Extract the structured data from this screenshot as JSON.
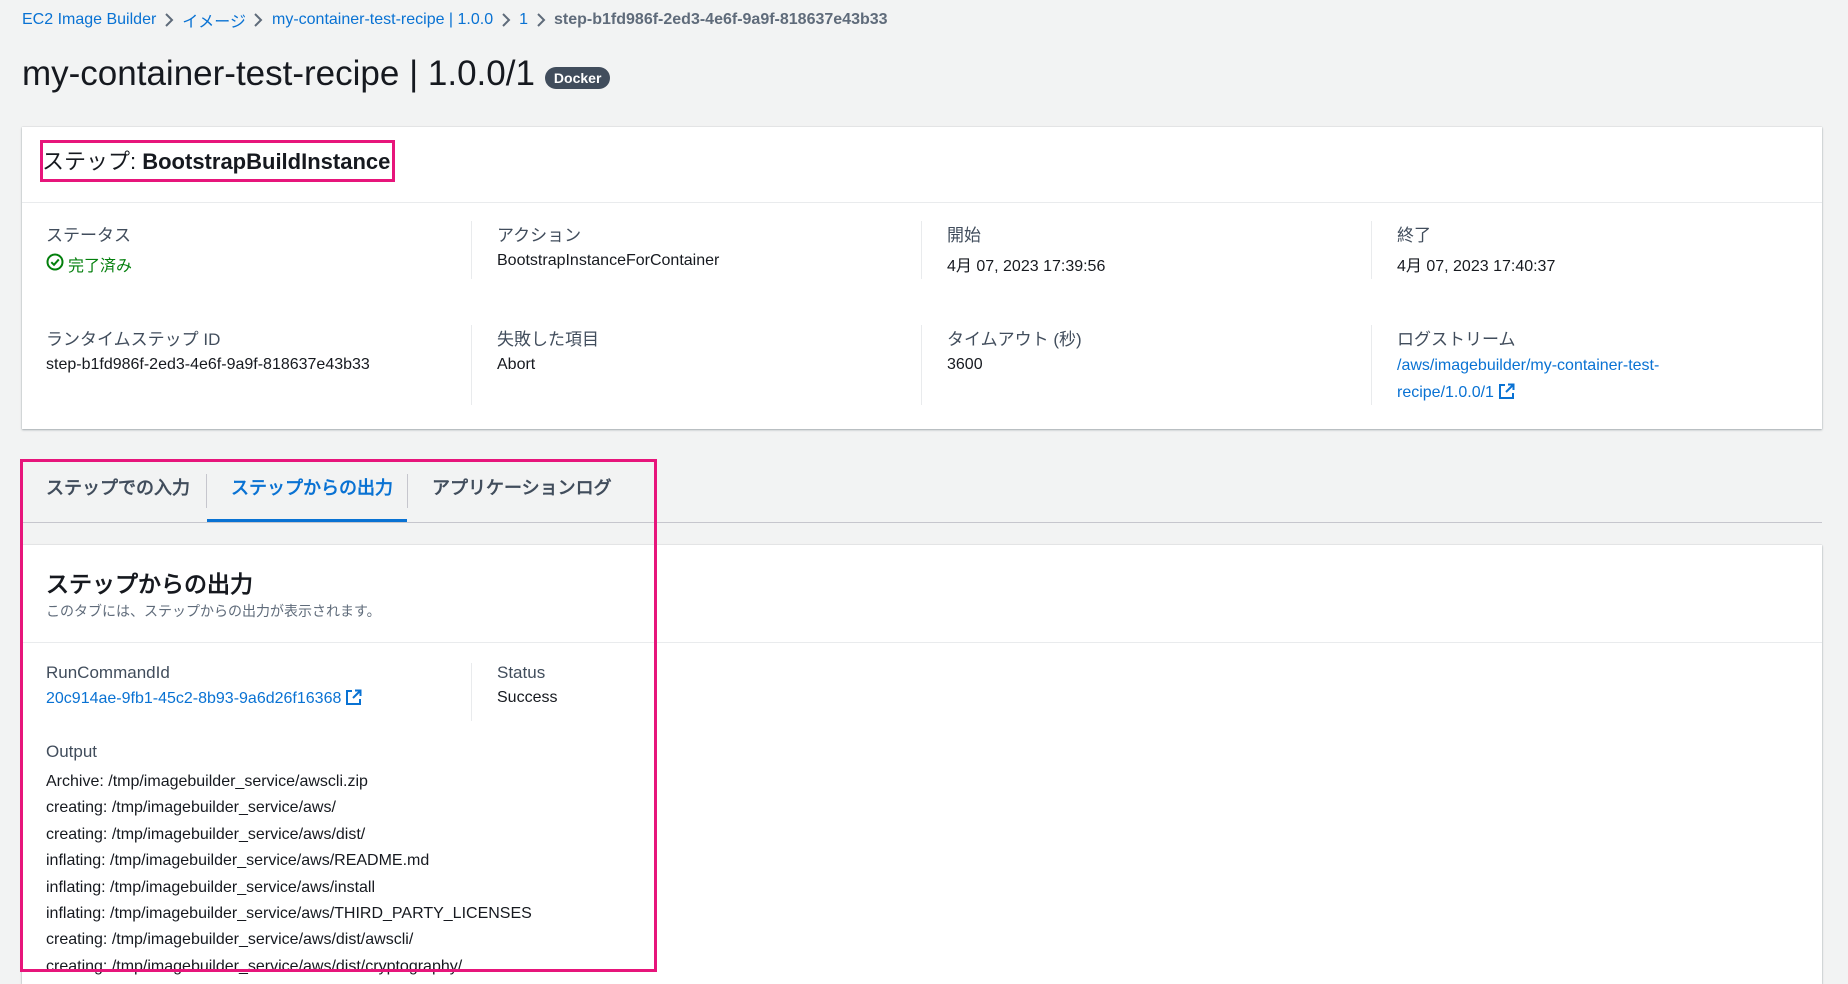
{
  "breadcrumb": {
    "items": [
      "EC2 Image Builder",
      "イメージ",
      "my-container-test-recipe | 1.0.0",
      "1"
    ],
    "current": "step-b1fd986f-2ed3-4e6f-9a9f-818637e43b33"
  },
  "page": {
    "title": "my-container-test-recipe | 1.0.0/1",
    "badge": "Docker"
  },
  "step": {
    "title_prefix": "ステップ: ",
    "title_name": "BootstrapBuildInstance",
    "fields": {
      "status_label": "ステータス",
      "status_value": "完了済み",
      "action_label": "アクション",
      "action_value": "BootstrapInstanceForContainer",
      "start_label": "開始",
      "start_value": "4月 07, 2023 17:39:56",
      "end_label": "終了",
      "end_value": "4月 07, 2023 17:40:37",
      "runtime_id_label": "ランタイムステップ ID",
      "runtime_id_value": "step-b1fd986f-2ed3-4e6f-9a9f-818637e43b33",
      "failed_item_label": "失敗した項目",
      "failed_item_value": "Abort",
      "timeout_label": "タイムアウト (秒)",
      "timeout_value": "3600",
      "log_stream_label": "ログストリーム",
      "log_stream_line1": "/aws/imagebuilder/my-container-test-",
      "log_stream_line2": "recipe/1.0.0/1"
    }
  },
  "tabs": [
    {
      "label": "ステップでの入力"
    },
    {
      "label": "ステップからの出力"
    },
    {
      "label": "アプリケーションログ"
    }
  ],
  "output": {
    "title": "ステップからの出力",
    "description": "このタブには、ステップからの出力が表示されます。",
    "run_command_label": "RunCommandId",
    "run_command_value": "20c914ae-9fb1-45c2-8b93-9a6d26f16368",
    "status_label": "Status",
    "status_value": "Success",
    "output_label": "Output",
    "lines": [
      "Archive: /tmp/imagebuilder_service/awscli.zip",
      "creating: /tmp/imagebuilder_service/aws/",
      "creating: /tmp/imagebuilder_service/aws/dist/",
      "inflating: /tmp/imagebuilder_service/aws/README.md",
      "inflating: /tmp/imagebuilder_service/aws/install",
      "inflating: /tmp/imagebuilder_service/aws/THIRD_PARTY_LICENSES",
      "creating: /tmp/imagebuilder_service/aws/dist/awscli/",
      "creating: /tmp/imagebuilder_service/aws/dist/cryptography/"
    ]
  },
  "colors": {
    "link": "#0972d3",
    "success": "#037f0c",
    "highlight": "#e7157b",
    "badge_bg": "#414d5c"
  },
  "icons": {
    "separator": "chevron-right-icon",
    "status": "check-circle-icon",
    "external": "external-link-icon"
  }
}
